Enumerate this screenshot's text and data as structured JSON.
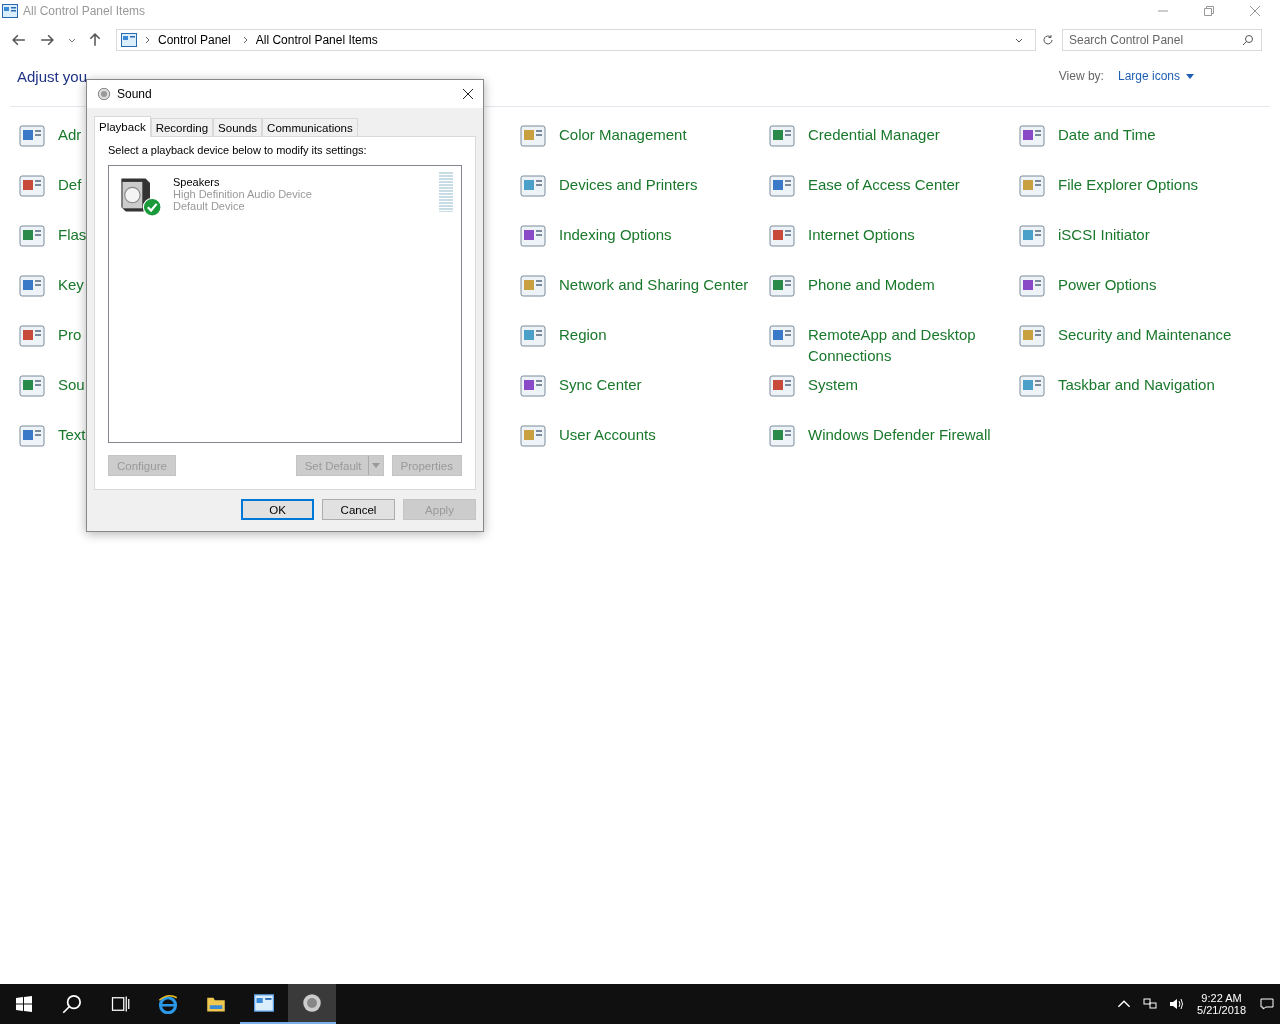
{
  "window": {
    "title": "All Control Panel Items"
  },
  "address_bar": {
    "breadcrumbs": [
      "Control Panel",
      "All Control Panel Items"
    ]
  },
  "search": {
    "placeholder": "Search Control Panel"
  },
  "heading": "Adjust you",
  "view_by": {
    "label": "View by:",
    "value": "Large icons"
  },
  "items": [
    {
      "label": "Adr"
    },
    {
      "label": "Color Management"
    },
    {
      "label": "Credential Manager"
    },
    {
      "label": "Date and Time"
    },
    {
      "label": "Def"
    },
    {
      "label": "Devices and Printers"
    },
    {
      "label": "Ease of Access Center"
    },
    {
      "label": "File Explorer Options"
    },
    {
      "label": "Flas"
    },
    {
      "label": "Indexing Options"
    },
    {
      "label": "Internet Options"
    },
    {
      "label": "iSCSI Initiator"
    },
    {
      "label": "Key"
    },
    {
      "label": "Network and Sharing Center"
    },
    {
      "label": "Phone and Modem"
    },
    {
      "label": "Power Options"
    },
    {
      "label": "Pro"
    },
    {
      "label": "Region"
    },
    {
      "label": "RemoteApp and Desktop Connections"
    },
    {
      "label": "Security and Maintenance"
    },
    {
      "label": "Sou"
    },
    {
      "label": "Sync Center"
    },
    {
      "label": "System"
    },
    {
      "label": "Taskbar and Navigation"
    },
    {
      "label": "Text"
    },
    {
      "label": "User Accounts"
    },
    {
      "label": "Windows Defender Firewall"
    }
  ],
  "dialog": {
    "title": "Sound",
    "tabs": [
      {
        "label": "Playback",
        "selected": true
      },
      {
        "label": "Recording",
        "selected": false
      },
      {
        "label": "Sounds",
        "selected": false
      },
      {
        "label": "Communications",
        "selected": false
      }
    ],
    "instruction": "Select a playback device below to modify its settings:",
    "devices": [
      {
        "name": "Speakers",
        "description": "High Definition Audio Device",
        "status": "Default Device",
        "default": true,
        "level": 0
      }
    ],
    "device_buttons": [
      {
        "label": "Configure",
        "disabled": true,
        "kind": "plain"
      },
      {
        "label": "Set Default",
        "disabled": true,
        "kind": "split"
      },
      {
        "label": "Properties",
        "disabled": true,
        "kind": "plain"
      }
    ],
    "buttons": [
      {
        "label": "OK",
        "disabled": false,
        "focused": true
      },
      {
        "label": "Cancel",
        "disabled": false,
        "focused": false
      },
      {
        "label": "Apply",
        "disabled": true,
        "focused": false
      }
    ]
  },
  "taskbar": {
    "items": [
      {
        "kind": "search",
        "open": false,
        "focused": false
      },
      {
        "kind": "task-view",
        "open": false,
        "focused": false
      },
      {
        "kind": "browser",
        "open": false,
        "focused": false
      },
      {
        "kind": "folder",
        "open": false,
        "focused": false
      },
      {
        "kind": "control-panel",
        "open": true,
        "focused": false
      },
      {
        "kind": "sound",
        "open": true,
        "focused": true
      }
    ],
    "time": "9:22 AM",
    "date": "5/21/2018"
  }
}
